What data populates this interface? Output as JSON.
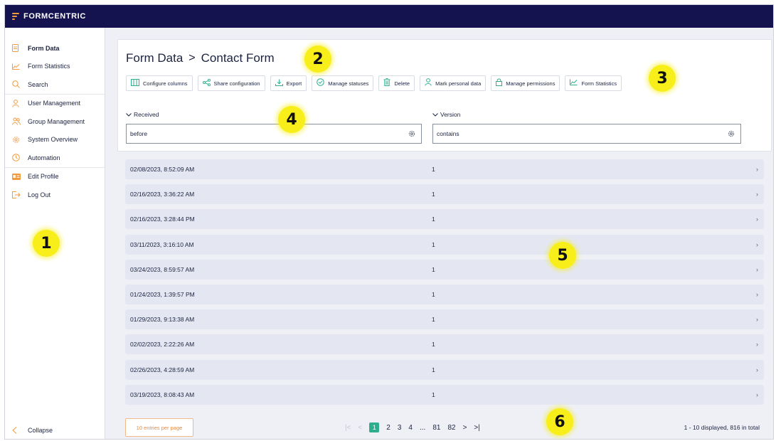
{
  "app": {
    "brand": "FORMCENTRIC"
  },
  "sidebar": {
    "items": [
      {
        "label": "Form Data",
        "icon": "document-icon",
        "active": true
      },
      {
        "label": "Form Statistics",
        "icon": "line-chart-icon"
      },
      {
        "label": "Search",
        "icon": "search-icon"
      },
      {
        "label": "User Management",
        "icon": "user-icon"
      },
      {
        "label": "Group Management",
        "icon": "group-icon"
      },
      {
        "label": "System Overview",
        "icon": "gear-icon"
      },
      {
        "label": "Automation",
        "icon": "clock-icon"
      },
      {
        "label": "Edit Profile",
        "icon": "id-card-icon"
      },
      {
        "label": "Log Out",
        "icon": "logout-icon"
      }
    ],
    "collapse_label": "Collapse"
  },
  "breadcrumb": {
    "parent": "Form Data",
    "separator": ">",
    "current": "Contact Form"
  },
  "toolbar": {
    "buttons": [
      {
        "label": "Configure columns",
        "icon": "columns-icon"
      },
      {
        "label": "Share configuration",
        "icon": "share-icon"
      },
      {
        "label": "Export",
        "icon": "download-icon"
      },
      {
        "label": "Manage statuses",
        "icon": "check-circle-icon"
      },
      {
        "label": "Delete",
        "icon": "trash-icon"
      },
      {
        "label": "Mark personal data",
        "icon": "user-icon"
      },
      {
        "label": "Manage permissions",
        "icon": "lock-icon"
      },
      {
        "label": "Form Statistics",
        "icon": "line-chart-icon"
      }
    ]
  },
  "filters": {
    "received": {
      "label": "Received",
      "value": "before"
    },
    "version": {
      "label": "Version",
      "value": "contains"
    }
  },
  "rows": [
    {
      "received": "02/08/2023, 8:52:09 AM",
      "version": "1"
    },
    {
      "received": "02/16/2023, 3:36:22 AM",
      "version": "1"
    },
    {
      "received": "02/16/2023, 3:28:44 PM",
      "version": "1"
    },
    {
      "received": "03/11/2023, 3:16:10 AM",
      "version": "1"
    },
    {
      "received": "03/24/2023, 8:59:57 AM",
      "version": "1"
    },
    {
      "received": "01/24/2023, 1:39:57 PM",
      "version": "1"
    },
    {
      "received": "01/29/2023, 9:13:38 AM",
      "version": "1"
    },
    {
      "received": "02/02/2023, 2:22:26 AM",
      "version": "1"
    },
    {
      "received": "02/26/2023, 4:28:59 AM",
      "version": "1"
    },
    {
      "received": "03/19/2023, 8:08:43 AM",
      "version": "1"
    }
  ],
  "pagination": {
    "per_page_label": "10 entries per page",
    "first": "|<",
    "prev": "<",
    "pages": [
      "1",
      "2",
      "3",
      "4",
      "...",
      "81",
      "82"
    ],
    "current_page": "1",
    "next": ">",
    "last": ">|",
    "summary": "1 - 10 displayed, 816 in total"
  },
  "markers": [
    "1",
    "2",
    "3",
    "4",
    "5",
    "6"
  ],
  "colors": {
    "topbar": "#14134f",
    "accent": "#f19a3e",
    "primary": "#2fae8d",
    "row_bg": "#e4e7f2",
    "marker": "#f7ee1a"
  }
}
